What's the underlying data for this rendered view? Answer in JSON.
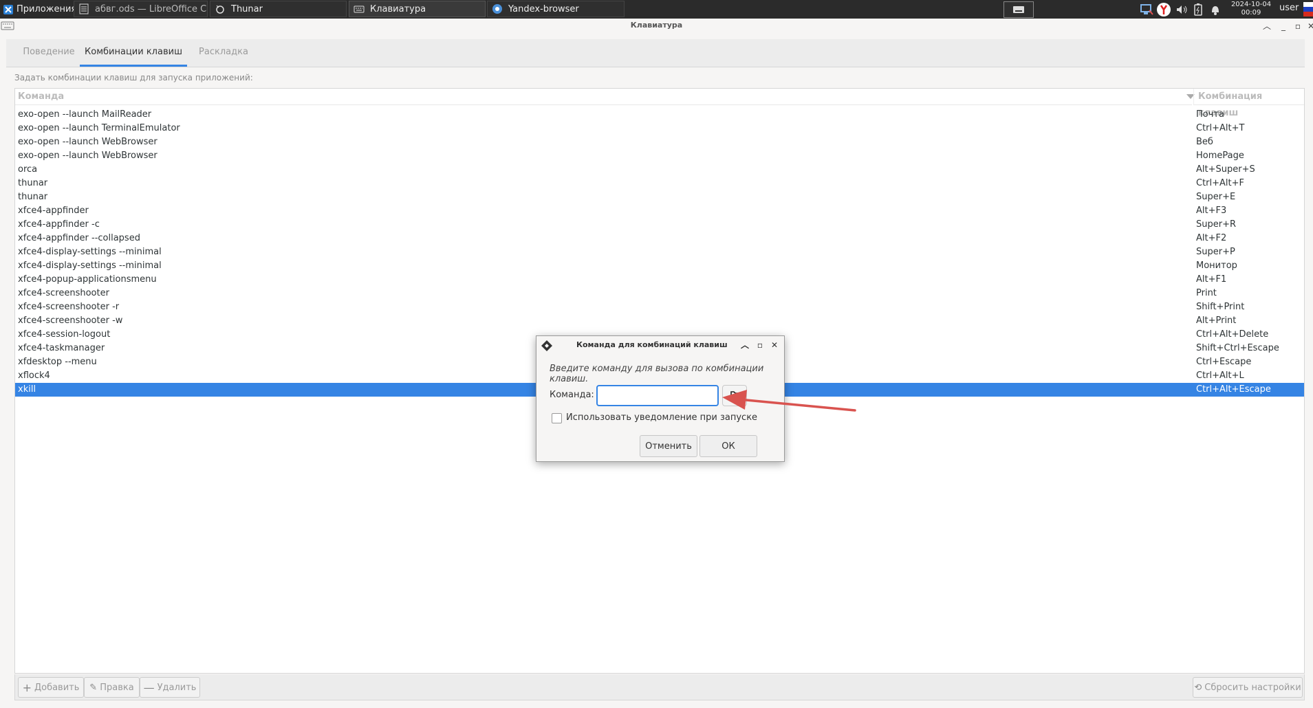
{
  "taskbar": {
    "apps_menu_label": "Приложения :",
    "tasks": [
      {
        "label": "абвг.ods — LibreOffice Calc",
        "icon": "spreadsheet-icon"
      },
      {
        "label": "Thunar",
        "icon": "file-manager-icon"
      },
      {
        "label": "Клавиатура",
        "icon": "keyboard-icon"
      },
      {
        "label": "Yandex-browser",
        "icon": "browser-icon"
      }
    ],
    "clock_date": "2024-10-04",
    "clock_time": "00:09",
    "user": "user"
  },
  "window": {
    "title": "Клавиатура",
    "tabs": [
      {
        "label": "Поведение"
      },
      {
        "label": "Комбинации клавиш"
      },
      {
        "label": "Раскладка"
      }
    ],
    "hint": "Задать комбинации клавиш для запуска приложений:",
    "columns": {
      "command": "Команда",
      "shortcut": "Комбинация клавиш"
    },
    "rows": [
      {
        "command": "exo-open --launch MailReader",
        "shortcut": "Почта"
      },
      {
        "command": "exo-open --launch TerminalEmulator",
        "shortcut": "Ctrl+Alt+T"
      },
      {
        "command": "exo-open --launch WebBrowser",
        "shortcut": "Веб"
      },
      {
        "command": "exo-open --launch WebBrowser",
        "shortcut": "HomePage"
      },
      {
        "command": "orca",
        "shortcut": "Alt+Super+S"
      },
      {
        "command": "thunar",
        "shortcut": "Ctrl+Alt+F"
      },
      {
        "command": "thunar",
        "shortcut": "Super+E"
      },
      {
        "command": "xfce4-appfinder",
        "shortcut": "Alt+F3"
      },
      {
        "command": "xfce4-appfinder -c",
        "shortcut": "Super+R"
      },
      {
        "command": "xfce4-appfinder --collapsed",
        "shortcut": "Alt+F2"
      },
      {
        "command": "xfce4-display-settings --minimal",
        "shortcut": "Super+P"
      },
      {
        "command": "xfce4-display-settings --minimal",
        "shortcut": "Монитор"
      },
      {
        "command": "xfce4-popup-applicationsmenu",
        "shortcut": "Alt+F1"
      },
      {
        "command": "xfce4-screenshooter",
        "shortcut": "Print"
      },
      {
        "command": "xfce4-screenshooter -r",
        "shortcut": "Shift+Print"
      },
      {
        "command": "xfce4-screenshooter -w",
        "shortcut": "Alt+Print"
      },
      {
        "command": "xfce4-session-logout",
        "shortcut": "Ctrl+Alt+Delete"
      },
      {
        "command": "xfce4-taskmanager",
        "shortcut": "Shift+Ctrl+Escape"
      },
      {
        "command": "xfdesktop --menu",
        "shortcut": "Ctrl+Escape"
      },
      {
        "command": "xflock4",
        "shortcut": "Ctrl+Alt+L"
      },
      {
        "command": "xkill",
        "shortcut": "Ctrl+Alt+Escape"
      }
    ],
    "selected_row_index": 20,
    "toolbar": {
      "add_label": "Добавить",
      "edit_label": "Правка",
      "remove_label": "Удалить",
      "reset_label": "Сбросить настройки"
    }
  },
  "dialog": {
    "title": "Команда для комбинаций клавиш",
    "prompt": "Введите команду для вызова по комбинации клавиш.",
    "command_label": "Команда:",
    "command_value": "",
    "notify_label": "Использовать уведомление при запуске",
    "notify_checked": false,
    "cancel_label": "Отменить",
    "ok_label": "ОК"
  },
  "colors": {
    "accent": "#3584e4",
    "annotation_arrow": "#d9534f",
    "panel_bg": "#2b2b2b"
  }
}
